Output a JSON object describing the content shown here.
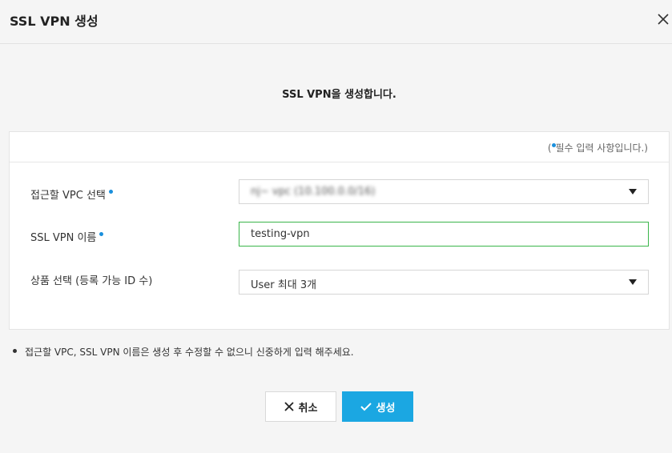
{
  "dialog": {
    "title": "SSL VPN 생성",
    "subtitle": "SSL VPN을 생성합니다."
  },
  "required_note": {
    "open": "(",
    "text": "필수 입력 사항입니다.)"
  },
  "form": {
    "vpc": {
      "label": "접근할 VPC 선택",
      "value": "nj~ vpc (10.100.0.0/16)"
    },
    "name": {
      "label": "SSL VPN 이름",
      "value": "testing-vpn"
    },
    "product": {
      "label": "상품 선택 (등록 가능 ID 수)",
      "value": "User 최대 3개"
    }
  },
  "notice": "접근할 VPC, SSL VPN 이름은 생성 후 수정할 수 없으니 신중하게 입력 해주세요.",
  "buttons": {
    "cancel": "취소",
    "create": "생성"
  },
  "colors": {
    "accent": "#1ba7e2",
    "required_dot": "#1a8fdc",
    "input_focus_border": "#3ab54a"
  },
  "icons": {
    "close": "close-icon",
    "cancel": "x-icon",
    "create": "check-icon",
    "dropdown": "caret-down-icon"
  }
}
